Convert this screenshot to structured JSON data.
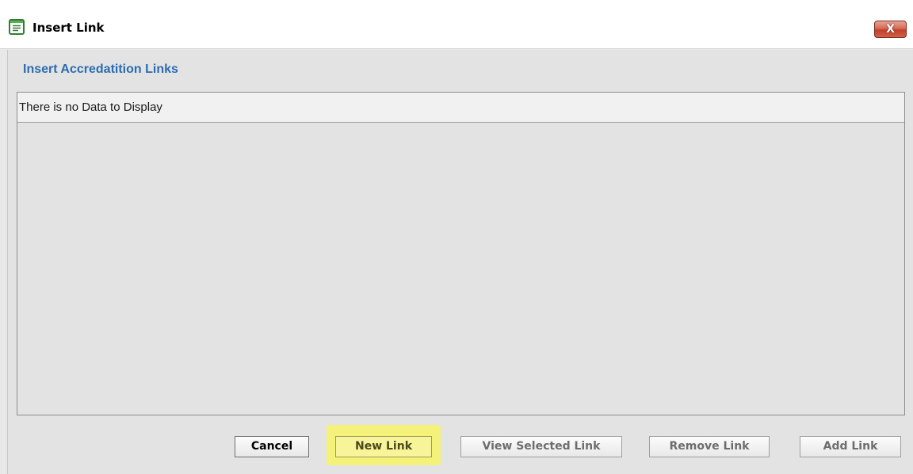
{
  "window": {
    "title": "Insert Link",
    "close_glyph": "X"
  },
  "section": {
    "title": "Insert Accredatition Links"
  },
  "grid": {
    "empty_message": "There is no Data to Display"
  },
  "buttons": {
    "cancel": "Cancel",
    "new_link": "New Link",
    "view_selected_link": "View Selected Link",
    "remove_link": "Remove Link",
    "add_link": "Add Link"
  },
  "icons": {
    "title_icon": "window-form-icon",
    "close_icon": "close-icon"
  },
  "colors": {
    "section_title": "#2b6cb0",
    "highlight": "#f5f27a",
    "close_button": "#c2402a"
  }
}
